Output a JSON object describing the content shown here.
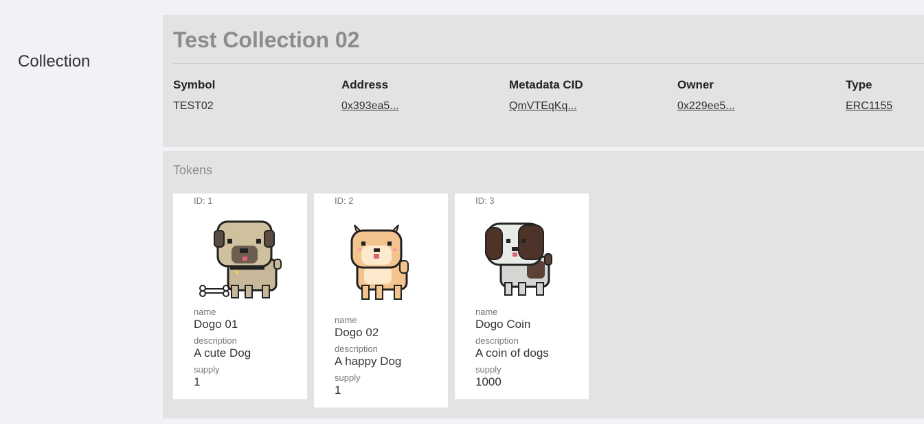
{
  "page": {
    "section_title": "Collection"
  },
  "collection": {
    "title": "Test Collection 02",
    "fields": [
      {
        "label": "Symbol",
        "value": "TEST02"
      },
      {
        "label": "Address",
        "value": "0x393ea5..."
      },
      {
        "label": "Metadata CID",
        "value": "QmVTEqKq..."
      },
      {
        "label": "Owner",
        "value": "0x229ee5..."
      },
      {
        "label": "Type",
        "value": "ERC1155"
      }
    ]
  },
  "tokens": {
    "title": "Tokens",
    "labels": {
      "name": "name",
      "description": "description",
      "supply": "supply"
    },
    "items": [
      {
        "id": "ID: 1",
        "name": "Dogo 01",
        "description": "A cute Dog",
        "supply": "1",
        "image": "pug-dog-icon"
      },
      {
        "id": "ID: 2",
        "name": "Dogo 02",
        "description": "A happy Dog",
        "supply": "1",
        "image": "shiba-dog-icon"
      },
      {
        "id": "ID: 3",
        "name": "Dogo Coin",
        "description": "A coin of dogs",
        "supply": "1000",
        "image": "shih-tzu-dog-icon"
      }
    ]
  },
  "colors": {
    "background": "#f1f2f5",
    "panel": "#e3e3e3",
    "muted_title": "#8c8c8c",
    "card": "#ffffff"
  }
}
